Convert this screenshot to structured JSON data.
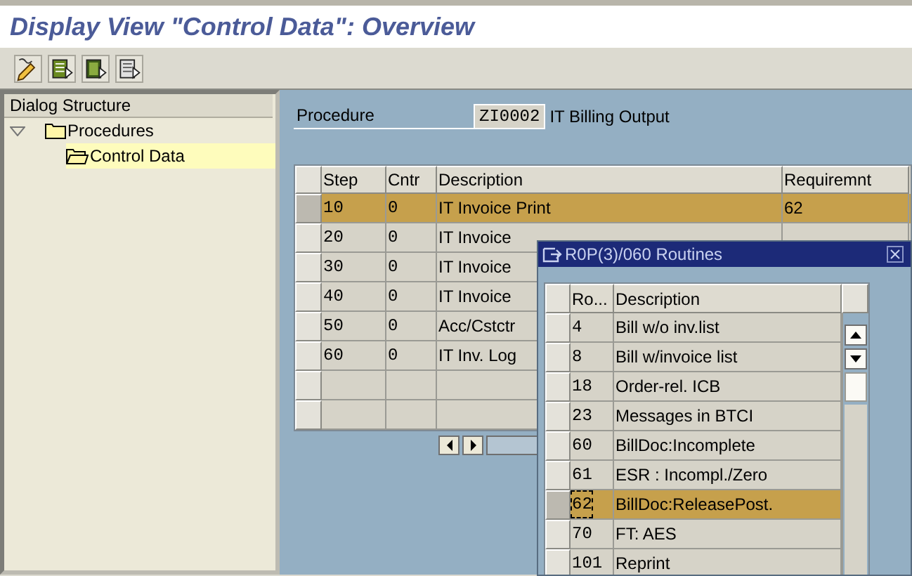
{
  "window": {
    "title": "Display View \"Control Data\": Overview"
  },
  "toolbar": {
    "buttons": [
      {
        "kind": "edit"
      },
      {
        "kind": "list-green"
      },
      {
        "kind": "list-dark"
      },
      {
        "kind": "list-plain"
      }
    ]
  },
  "dialog_structure": {
    "title": "Dialog Structure",
    "items": [
      {
        "label": "Procedures",
        "expanded": true,
        "selected": false,
        "children": [
          {
            "label": "Control Data",
            "selected": true
          }
        ]
      }
    ]
  },
  "procedure": {
    "label": "Procedure",
    "value": "ZI0002",
    "description": "IT Billing Output"
  },
  "table": {
    "columns": [
      "Step",
      "Cntr",
      "Description",
      "Requiremnt"
    ],
    "rows": [
      {
        "step": "10",
        "cntr": "0",
        "description": "IT Invoice Print",
        "requirement": "62",
        "selected": true
      },
      {
        "step": "20",
        "cntr": "0",
        "description": "IT Invoice",
        "selected": false
      },
      {
        "step": "30",
        "cntr": "0",
        "description": "IT Invoice",
        "selected": false
      },
      {
        "step": "40",
        "cntr": "0",
        "description": "IT Invoice",
        "selected": false
      },
      {
        "step": "50",
        "cntr": "0",
        "description": "Acc/Cstctr",
        "selected": false
      },
      {
        "step": "60",
        "cntr": "0",
        "description": "IT Inv. Log",
        "selected": false
      }
    ]
  },
  "popup": {
    "title": "R0P(3)/060 Routines",
    "columns": [
      "Ro...",
      "Description"
    ],
    "rows": [
      {
        "number": "4",
        "description": "Bill w/o inv.list",
        "selected": false
      },
      {
        "number": "8",
        "description": "Bill w/invoice list",
        "selected": false
      },
      {
        "number": "18",
        "description": "Order-rel. ICB",
        "selected": false
      },
      {
        "number": "23",
        "description": "Messages in BTCI",
        "selected": false
      },
      {
        "number": "60",
        "description": "BillDoc:Incomplete",
        "selected": false
      },
      {
        "number": "61",
        "description": "ESR : Incompl./Zero",
        "selected": false
      },
      {
        "number": "62",
        "description": "BillDoc:ReleasePost.",
        "selected": true
      },
      {
        "number": "70",
        "description": "FT: AES",
        "selected": false
      },
      {
        "number": "101",
        "description": "Reprint",
        "selected": false
      }
    ]
  }
}
